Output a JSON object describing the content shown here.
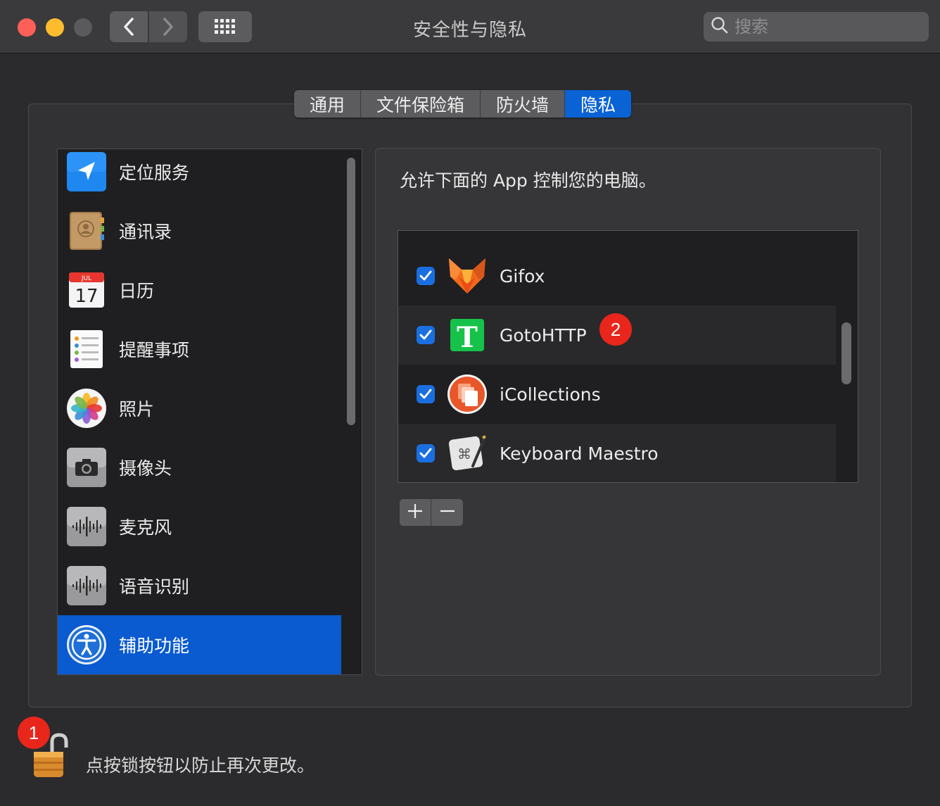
{
  "window": {
    "title": "安全性与隐私",
    "search_placeholder": "搜索"
  },
  "tabs": [
    {
      "label": "通用",
      "active": false
    },
    {
      "label": "文件保险箱",
      "active": false
    },
    {
      "label": "防火墙",
      "active": false
    },
    {
      "label": "隐私",
      "active": true
    }
  ],
  "sidebar": {
    "items": [
      {
        "label": "定位服务",
        "icon": "location-arrow-icon"
      },
      {
        "label": "通讯录",
        "icon": "contacts-icon"
      },
      {
        "label": "日历",
        "icon": "calendar-icon",
        "calendar_month": "JUL",
        "calendar_day": "17"
      },
      {
        "label": "提醒事项",
        "icon": "reminders-icon"
      },
      {
        "label": "照片",
        "icon": "photos-icon"
      },
      {
        "label": "摄像头",
        "icon": "camera-icon"
      },
      {
        "label": "麦克风",
        "icon": "microphone-icon"
      },
      {
        "label": "语音识别",
        "icon": "speech-recognition-icon"
      },
      {
        "label": "辅助功能",
        "icon": "accessibility-icon",
        "selected": true
      }
    ]
  },
  "panel": {
    "description": "允许下面的 App 控制您的电脑。",
    "apps": [
      {
        "name": "Gifox",
        "checked": true,
        "icon": "gifox-icon"
      },
      {
        "name": "GotoHTTP",
        "checked": true,
        "icon": "gotohttp-icon",
        "icon_letter": "T"
      },
      {
        "name": "iCollections",
        "checked": true,
        "icon": "icollections-icon"
      },
      {
        "name": "Keyboard Maestro",
        "checked": true,
        "icon": "keyboard-maestro-icon"
      }
    ],
    "add_label": "+",
    "remove_label": "−"
  },
  "annotations": {
    "badge1": "1",
    "badge2": "2"
  },
  "footer": {
    "lock_text": "点按锁按钮以防止再次更改。"
  },
  "colors": {
    "accent": "#0a63d4",
    "badge": "#e8261c",
    "checkbox": "#1a6fe0"
  }
}
